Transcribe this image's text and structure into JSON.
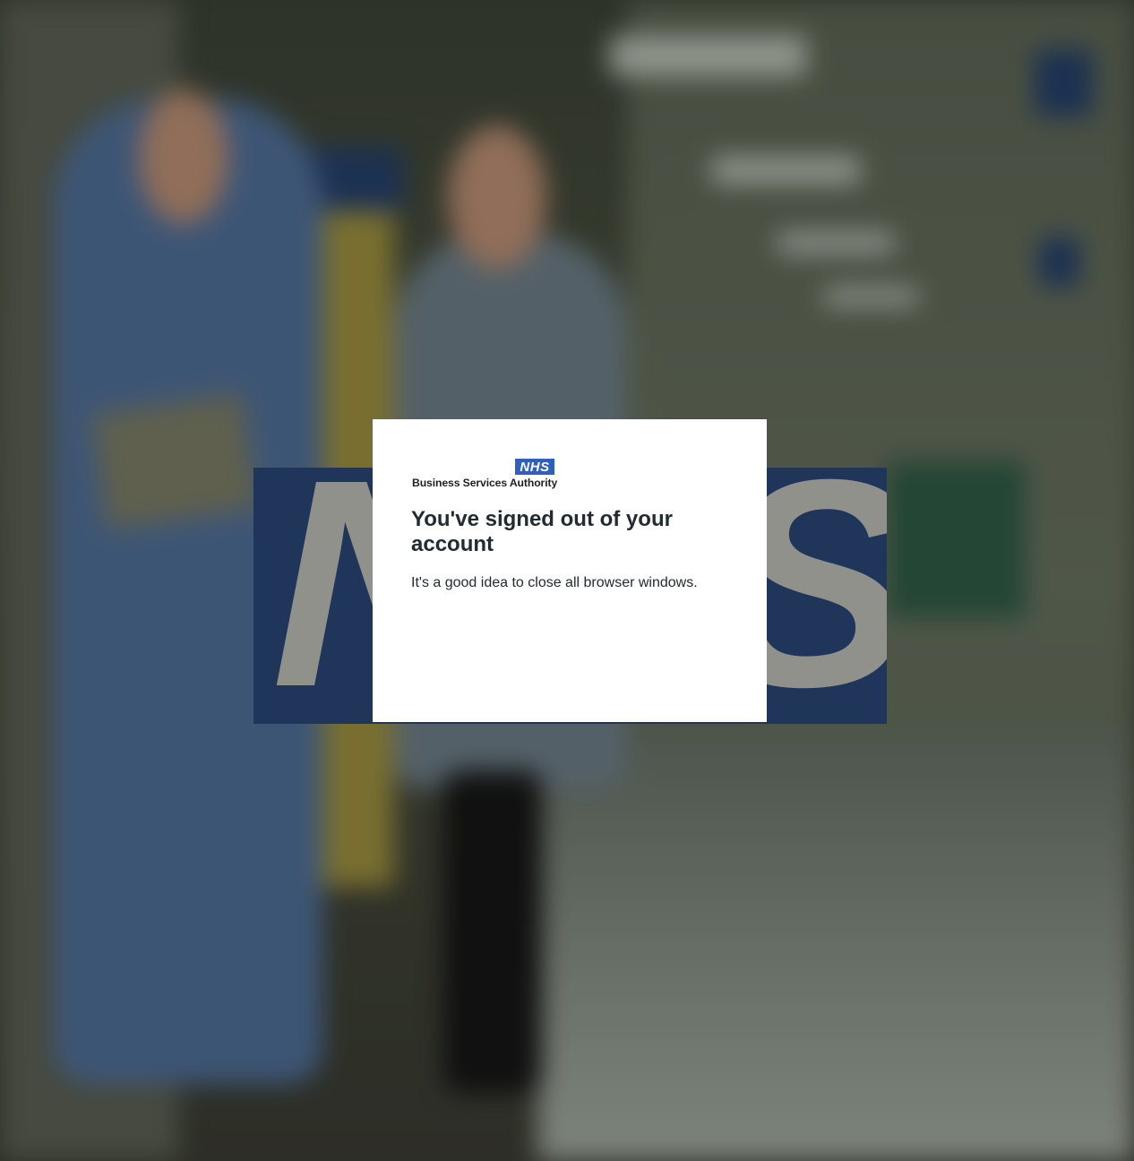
{
  "background": {
    "banner_logo_text": "NHS"
  },
  "dialog": {
    "logo": {
      "mark": "NHS",
      "subtitle": "Business Services Authority"
    },
    "title": "You've signed out of your account",
    "message": "It's a good idea to close all browser windows."
  },
  "colors": {
    "nhs_blue": "#2f5fbf",
    "banner_blue": "#2a4474",
    "text": "#212b32",
    "dialog_bg": "#ffffff"
  }
}
